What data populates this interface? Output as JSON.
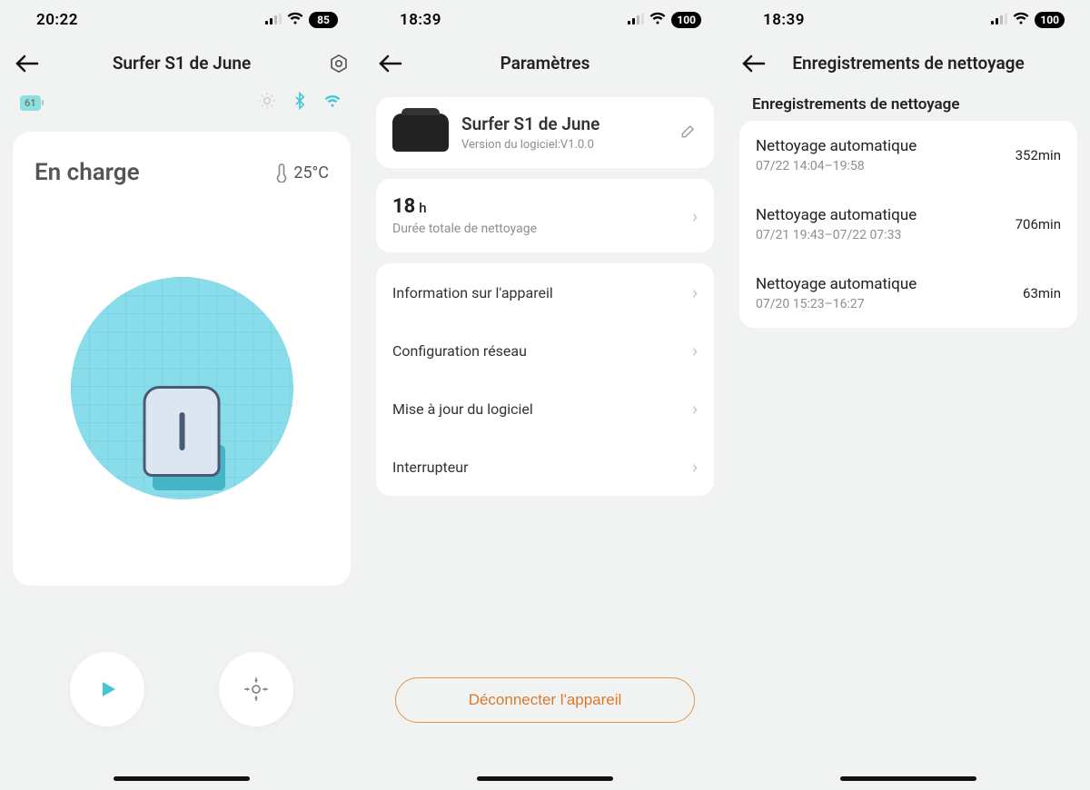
{
  "colors": {
    "accent": "#44c6d4",
    "warn": "#d97a2a"
  },
  "screens": [
    {
      "status": {
        "time": "20:22",
        "battery": "85"
      },
      "title": "Surfer S1 de June",
      "battery_badge": "61",
      "status_label": "En charge",
      "temp": "25°C"
    },
    {
      "status": {
        "time": "18:39",
        "battery": "100"
      },
      "title": "Paramètres",
      "device": {
        "name": "Surfer S1 de June",
        "version": "Version du logiciel:V1.0.0"
      },
      "hours": {
        "value": "18",
        "unit": "h",
        "label": "Durée totale de nettoyage"
      },
      "menu": [
        "Information sur l'appareil",
        "Configuration réseau",
        "Mise à jour du logiciel",
        "Interrupteur"
      ],
      "disconnect": "Déconnecter l'appareil"
    },
    {
      "status": {
        "time": "18:39",
        "battery": "100"
      },
      "title": "Enregistrements de nettoyage",
      "heading": "Enregistrements de nettoyage",
      "records": [
        {
          "title": "Nettoyage automatique",
          "range": "07/22 14:04–19:58",
          "duration": "352min"
        },
        {
          "title": "Nettoyage automatique",
          "range": "07/21 19:43–07/22 07:33",
          "duration": "706min"
        },
        {
          "title": "Nettoyage automatique",
          "range": "07/20 15:23–16:27",
          "duration": "63min"
        }
      ]
    }
  ]
}
